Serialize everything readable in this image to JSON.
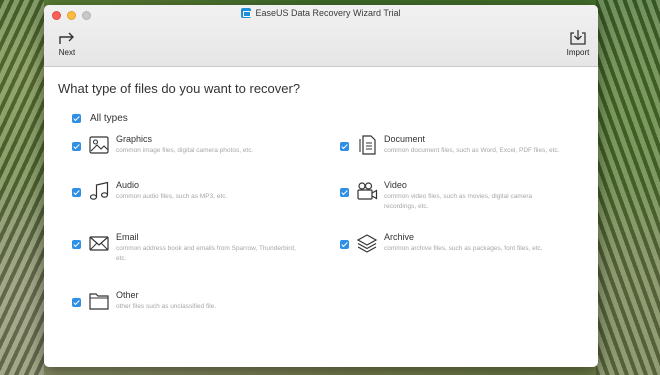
{
  "window": {
    "title": "EaseUS Data Recovery Wizard Trial"
  },
  "toolbar": {
    "next_label": "Next",
    "import_label": "Import"
  },
  "main": {
    "question": "What type of files do you want to recover?",
    "all_types_label": "All types",
    "file_types": [
      {
        "name": "Graphics",
        "description": "common image files, digital camera photos, etc.",
        "icon": "image-icon",
        "checked": true
      },
      {
        "name": "Document",
        "description": "common document files, such as Word, Excel, PDF files, etc.",
        "icon": "document-icon",
        "checked": true
      },
      {
        "name": "Audio",
        "description": "common audio files, such as MP3, etc.",
        "icon": "music-note-icon",
        "checked": true
      },
      {
        "name": "Video",
        "description": "common video files, such as movies, digital camera recordings, etc.",
        "icon": "video-camera-icon",
        "checked": true
      },
      {
        "name": "Email",
        "description": "common address book and emails from Sparrow, Thunderbird, etc.",
        "icon": "envelope-icon",
        "checked": true
      },
      {
        "name": "Archive",
        "description": "common archive files, such as packages, font files, etc.",
        "icon": "layers-icon",
        "checked": true
      },
      {
        "name": "Other",
        "description": "other files such as unclassified file.",
        "icon": "folder-icon",
        "checked": true
      }
    ]
  },
  "colors": {
    "checkbox": "#2f8ee6",
    "accent": "#1d8fd6"
  }
}
